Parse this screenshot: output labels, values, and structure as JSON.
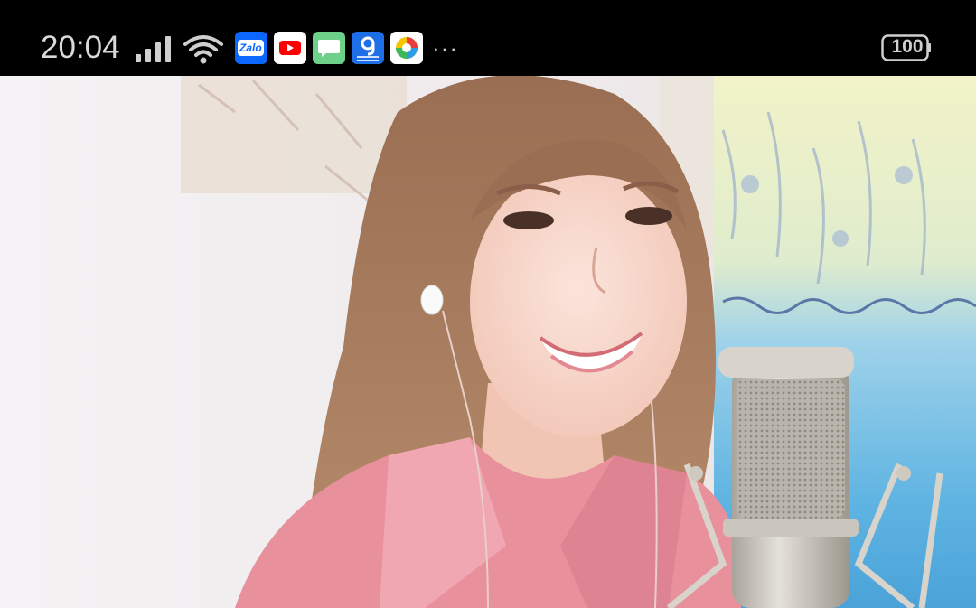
{
  "status_bar": {
    "time": "20:04",
    "battery_level": "100",
    "more_indicator": "···",
    "notification_apps": [
      "Zalo",
      "YouTube",
      "Messages",
      "9GAG",
      "Color app"
    ],
    "zalo_label": "Zalo"
  },
  "video": {
    "scene": "woman-singing-with-microphone"
  },
  "colors": {
    "status_bar_bg": "#000000",
    "status_text": "#d9d9d9",
    "shirt_pink": "#e8909c",
    "hair_brown": "#8a6248",
    "mic_silver": "#c9c5bd"
  }
}
